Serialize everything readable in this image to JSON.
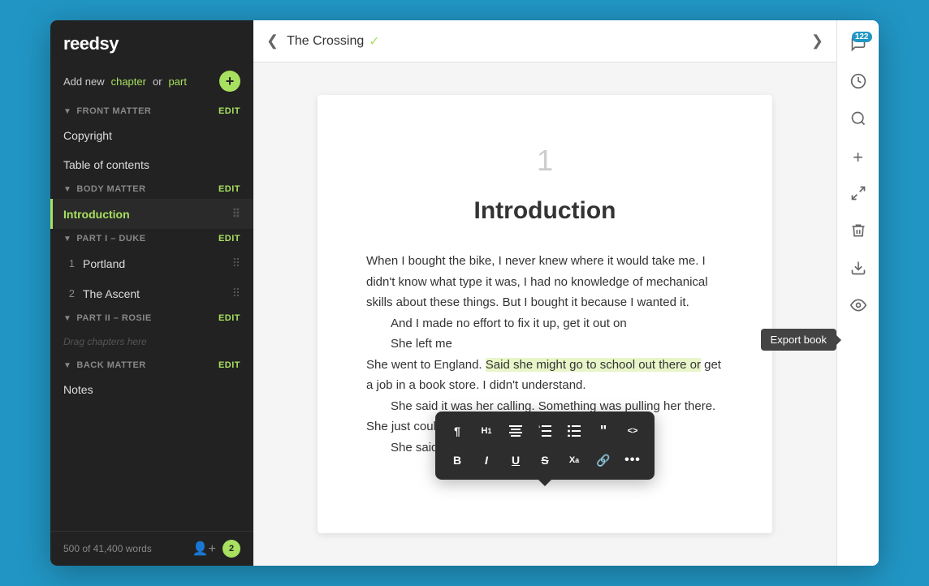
{
  "app": {
    "name": "reedsy"
  },
  "sidebar": {
    "add_label": "Add new",
    "chapter_link": "chapter",
    "or_text": "or",
    "part_link": "part",
    "front_matter_label": "FRONT MATTER",
    "front_matter_edit": "EDIT",
    "copyright_label": "Copyright",
    "toc_label": "Table of contents",
    "body_matter_label": "BODY MATTER",
    "body_matter_edit": "EDIT",
    "active_item": "Introduction",
    "part1_label": "PART I – Duke",
    "part1_edit": "EDIT",
    "item1_num": "1",
    "item1_label": "Portland",
    "item2_num": "2",
    "item2_label": "The Ascent",
    "part2_label": "PART II – Rosie",
    "part2_edit": "EDIT",
    "drag_hint": "Drag chapters here",
    "back_matter_label": "BACK MATTER",
    "back_matter_edit": "EDIT",
    "notes_label": "Notes",
    "word_count": "500 of 41,400 words",
    "notification_count": "2"
  },
  "topbar": {
    "title": "The Crossing",
    "back_arrow": "❮",
    "next_arrow": "❯",
    "check_icon": "✓"
  },
  "editor": {
    "page_number": "1",
    "chapter_title": "Introduction",
    "paragraph1": "When I bought the bike, I never knew where it would take me. I didn't know what type it was, I had no knowledge of mechanical skills about these things. But I bought it because I wanted it.",
    "paragraph2": "And I made no effort to fix it up, get it out on",
    "paragraph3": "She left me",
    "paragraph4_pre": "She went to England.",
    "paragraph4_highlight": "Said she might go to school out there or",
    "paragraph4_post": "get a job in a book store. I didn't understand.",
    "paragraph5": "She said it was her calling. Something was pulling her there. She just couldn't ignore it any longer.",
    "paragraph6": "She said it was"
  },
  "format_toolbar": {
    "paragraph_btn": "¶",
    "h1_btn": "H₁",
    "align_btn": "≡",
    "list_btn": "≔",
    "list2_btn": "≕",
    "quote_btn": "❝",
    "code_btn": "<>",
    "bold_btn": "B",
    "italic_btn": "I",
    "underline_btn": "U",
    "strikethrough_btn": "S̶",
    "superscript_btn": "Xᵃ",
    "link_btn": "🔗",
    "more_btn": "•••"
  },
  "right_toolbar": {
    "comment_icon": "💬",
    "comment_badge": "122",
    "history_icon": "🕐",
    "search_icon": "🔍",
    "add_icon": "+",
    "share_icon": "⇄",
    "delete_icon": "🗑",
    "export_icon": "⬇",
    "export_label": "Export book",
    "preview_icon": "👁"
  }
}
